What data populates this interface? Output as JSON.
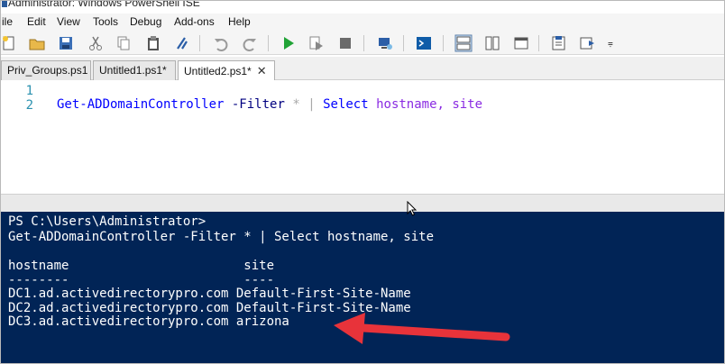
{
  "window": {
    "title": "Administrator: Windows PowerShell ISE"
  },
  "menu": {
    "items": [
      "ile",
      "Edit",
      "View",
      "Tools",
      "Debug",
      "Add-ons",
      "Help"
    ]
  },
  "toolbar": {
    "icons": [
      "new-icon",
      "open-icon",
      "save-icon",
      "cut-icon",
      "copy-icon",
      "paste-icon",
      "clear-icon",
      "undo-icon",
      "redo-icon",
      "run-icon",
      "run-selection-icon",
      "stop-icon",
      "remote-icon",
      "console-icon",
      "layout-top-icon",
      "layout-right-icon",
      "layout-max-icon",
      "show-commands-icon",
      "addon-icon"
    ],
    "overflow": "⩦"
  },
  "tabs": [
    {
      "label": "Priv_Groups.ps1",
      "active": false
    },
    {
      "label": "Untitled1.ps1*",
      "active": false
    },
    {
      "label": "Untitled2.ps1*",
      "active": true,
      "close": "✕"
    }
  ],
  "editor": {
    "line_numbers": [
      "1",
      "2"
    ],
    "code": {
      "cmdlet": "Get-ADDomainController",
      "param": "-Filter",
      "star": "*",
      "pipe": "|",
      "select": "Select",
      "args": "hostname, site"
    }
  },
  "console": {
    "lines": [
      "PS C:\\Users\\Administrator>",
      "Get-ADDomainController -Filter * | Select hostname, site",
      "",
      "hostname                       site",
      "--------                       ----",
      "DC1.ad.activedirectorypro.com Default-First-Site-Name",
      "DC2.ad.activedirectorypro.com Default-First-Site-Name",
      "DC3.ad.activedirectorypro.com arizona"
    ]
  },
  "colors": {
    "console_bg": "#012456",
    "annotation_arrow": "#e8333a",
    "cmdlet": "#0000ff",
    "keyword_text": "#8a2be2"
  }
}
